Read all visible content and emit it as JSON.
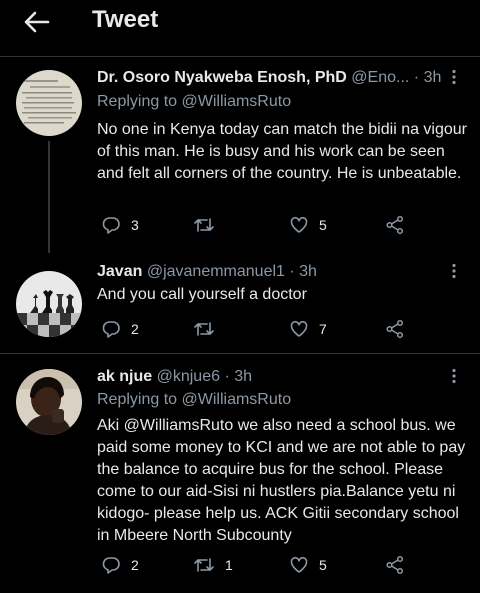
{
  "header": {
    "title": "Tweet"
  },
  "tweets": [
    {
      "name": "Dr. Osoro Nyakweba Enosh, PhD",
      "handle": "@Eno...",
      "time": "· 3h",
      "replying_prefix": "Replying to",
      "replying_to": "@WilliamsRuto",
      "text": "No one in Kenya today can match the bidii na vigour of this man. He is busy and his work can be seen and felt all corners of the country. He is unbeatable.",
      "replies": "3",
      "retweets": "",
      "likes": "5"
    },
    {
      "name": "Javan",
      "handle": "@javanemmanuel1",
      "time": "· 3h",
      "text": "And you call yourself a doctor",
      "replies": "2",
      "retweets": "",
      "likes": "7"
    },
    {
      "name": "ak njue",
      "handle": "@knjue6",
      "time": "· 3h",
      "replying_prefix": "Replying to",
      "replying_to": "@WilliamsRuto",
      "text": "Aki @WilliamsRuto we also need a school bus. we paid some money to KCI  and we are not able to pay the balance to acquire bus for the school. Please come to our aid-Sisi ni hustlers pia.Balance yetu ni kidogo- please help us. ACK Gitii secondary school in Mbeere North Subcounty",
      "replies": "2",
      "retweets": "1",
      "likes": "5"
    }
  ],
  "colors": {
    "background": "#000000",
    "text": "#e7e9ea",
    "muted": "#8b98a5",
    "divider": "#2f3336"
  }
}
